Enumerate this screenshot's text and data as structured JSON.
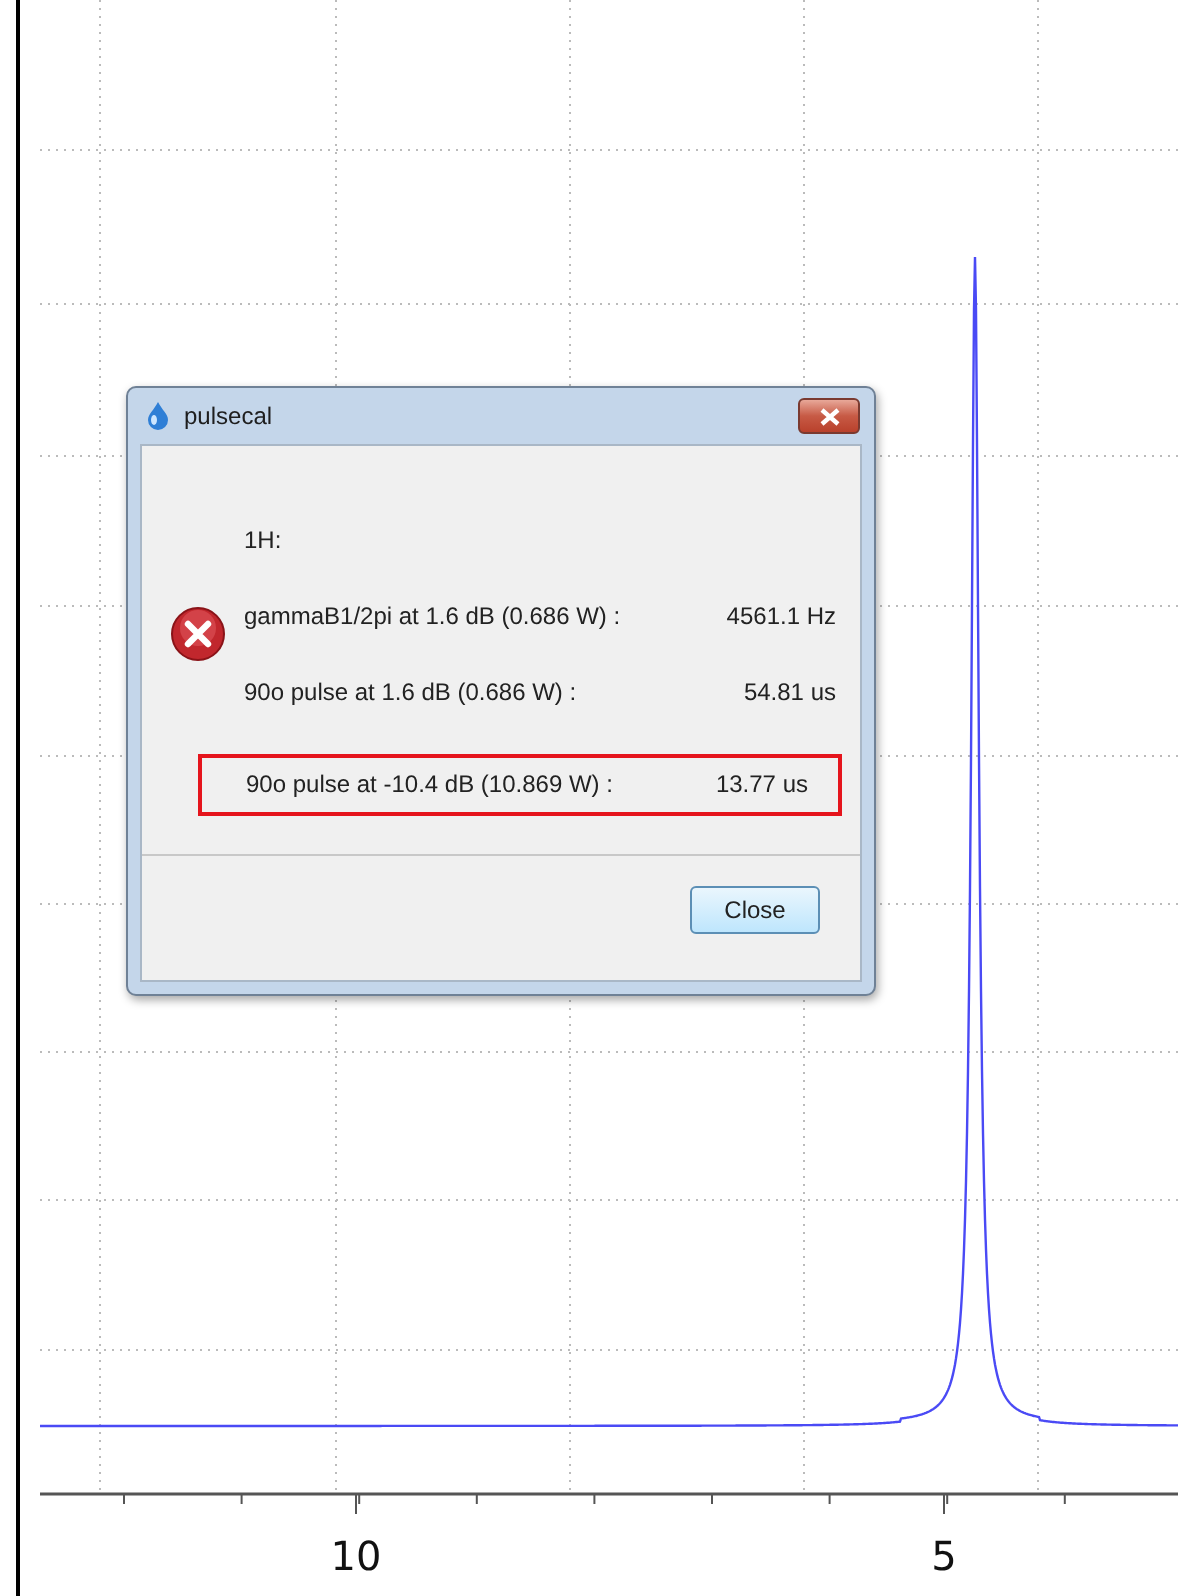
{
  "plot": {
    "axis_labels": [
      "10",
      "5"
    ]
  },
  "dialog": {
    "title": "pulsecal",
    "nucleus": "1H:",
    "rows": [
      {
        "label": "gammaB1/2pi at 1.6 dB (0.686 W) :",
        "value": "4561.1 Hz",
        "highlighted": false
      },
      {
        "label": "90o pulse at 1.6 dB (0.686 W) :",
        "value": "54.81 us",
        "highlighted": false
      },
      {
        "label": "90o pulse at -10.4 dB (10.869 W) :",
        "value": "13.77 us",
        "highlighted": true
      }
    ],
    "buttons": [
      "Close"
    ]
  }
}
